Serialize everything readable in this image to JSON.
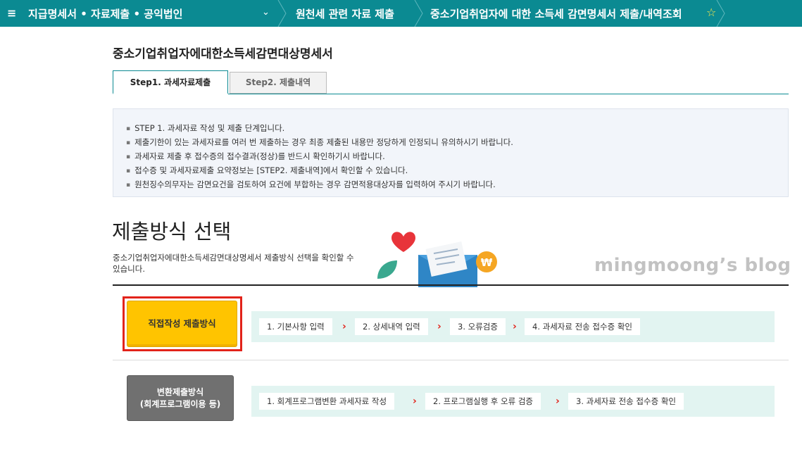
{
  "nav": {
    "menu_glyph": "≡",
    "crumb1": "지급명세서 • 자료제출 • 공익법인",
    "crumb2": "원천세 관련 자료 제출",
    "crumb3": "중소기업취업자에 대한 소득세 감면명세서 제출/내역조회",
    "star_glyph": "☆"
  },
  "page": {
    "title": "중소기업취업자에대한소득세감면대상명세서"
  },
  "tabs": [
    {
      "label": "Step1. 과세자료제출",
      "active": true
    },
    {
      "label": "Step2. 제출내역",
      "active": false
    }
  ],
  "info": [
    "STEP 1. 과세자료 작성 및 제출 단계입니다.",
    "제출기한이 있는 과세자료를 여러 번 제출하는 경우 최종 제출된 내용만 정당하게 인정되니 유의하시기 바랍니다.",
    "과세자료 제출 후 접수증의 접수결과(정상)를 반드시 확인하기시 바랍니다.",
    "접수증 및 과세자료제출 요약정보는 [STEP2. 제출내역]에서 확인할 수 있습니다.",
    "원천징수의무자는 감면요건을 검토하여 요건에 부합하는 경우 감면적용대상자를 입력하여 주시기 바랍니다."
  ],
  "section": {
    "title": "제출방식 선택",
    "desc": "중소기업취업자에대한소득세감면대상명세서 제출방식 선택을 확인할 수 있습니다."
  },
  "watermark": "mingmoong’s blog",
  "methods": {
    "direct": {
      "label": "직접작성 제출방식",
      "steps": [
        "1. 기본사항 입력",
        "2. 상세내역 입력",
        "3. 오류검증",
        "4. 과세자료 전송 접수증 확인"
      ]
    },
    "convert": {
      "label_line1": "변환제출방식",
      "label_line2": "(회계프로그램이용 등)",
      "steps": [
        "1. 회계프로그램변환 과세자료 작성",
        "2. 프로그램실행 후 오류 검증",
        "3. 과세자료 전송 접수증 확인"
      ]
    },
    "arrow_glyph": "›"
  },
  "colors": {
    "nav_bg": "#0b8a92",
    "direct_btn": "#ffc400",
    "highlight": "#e2231a",
    "flow_bg": "#e2f4f1",
    "arrow": "#e2231a"
  }
}
